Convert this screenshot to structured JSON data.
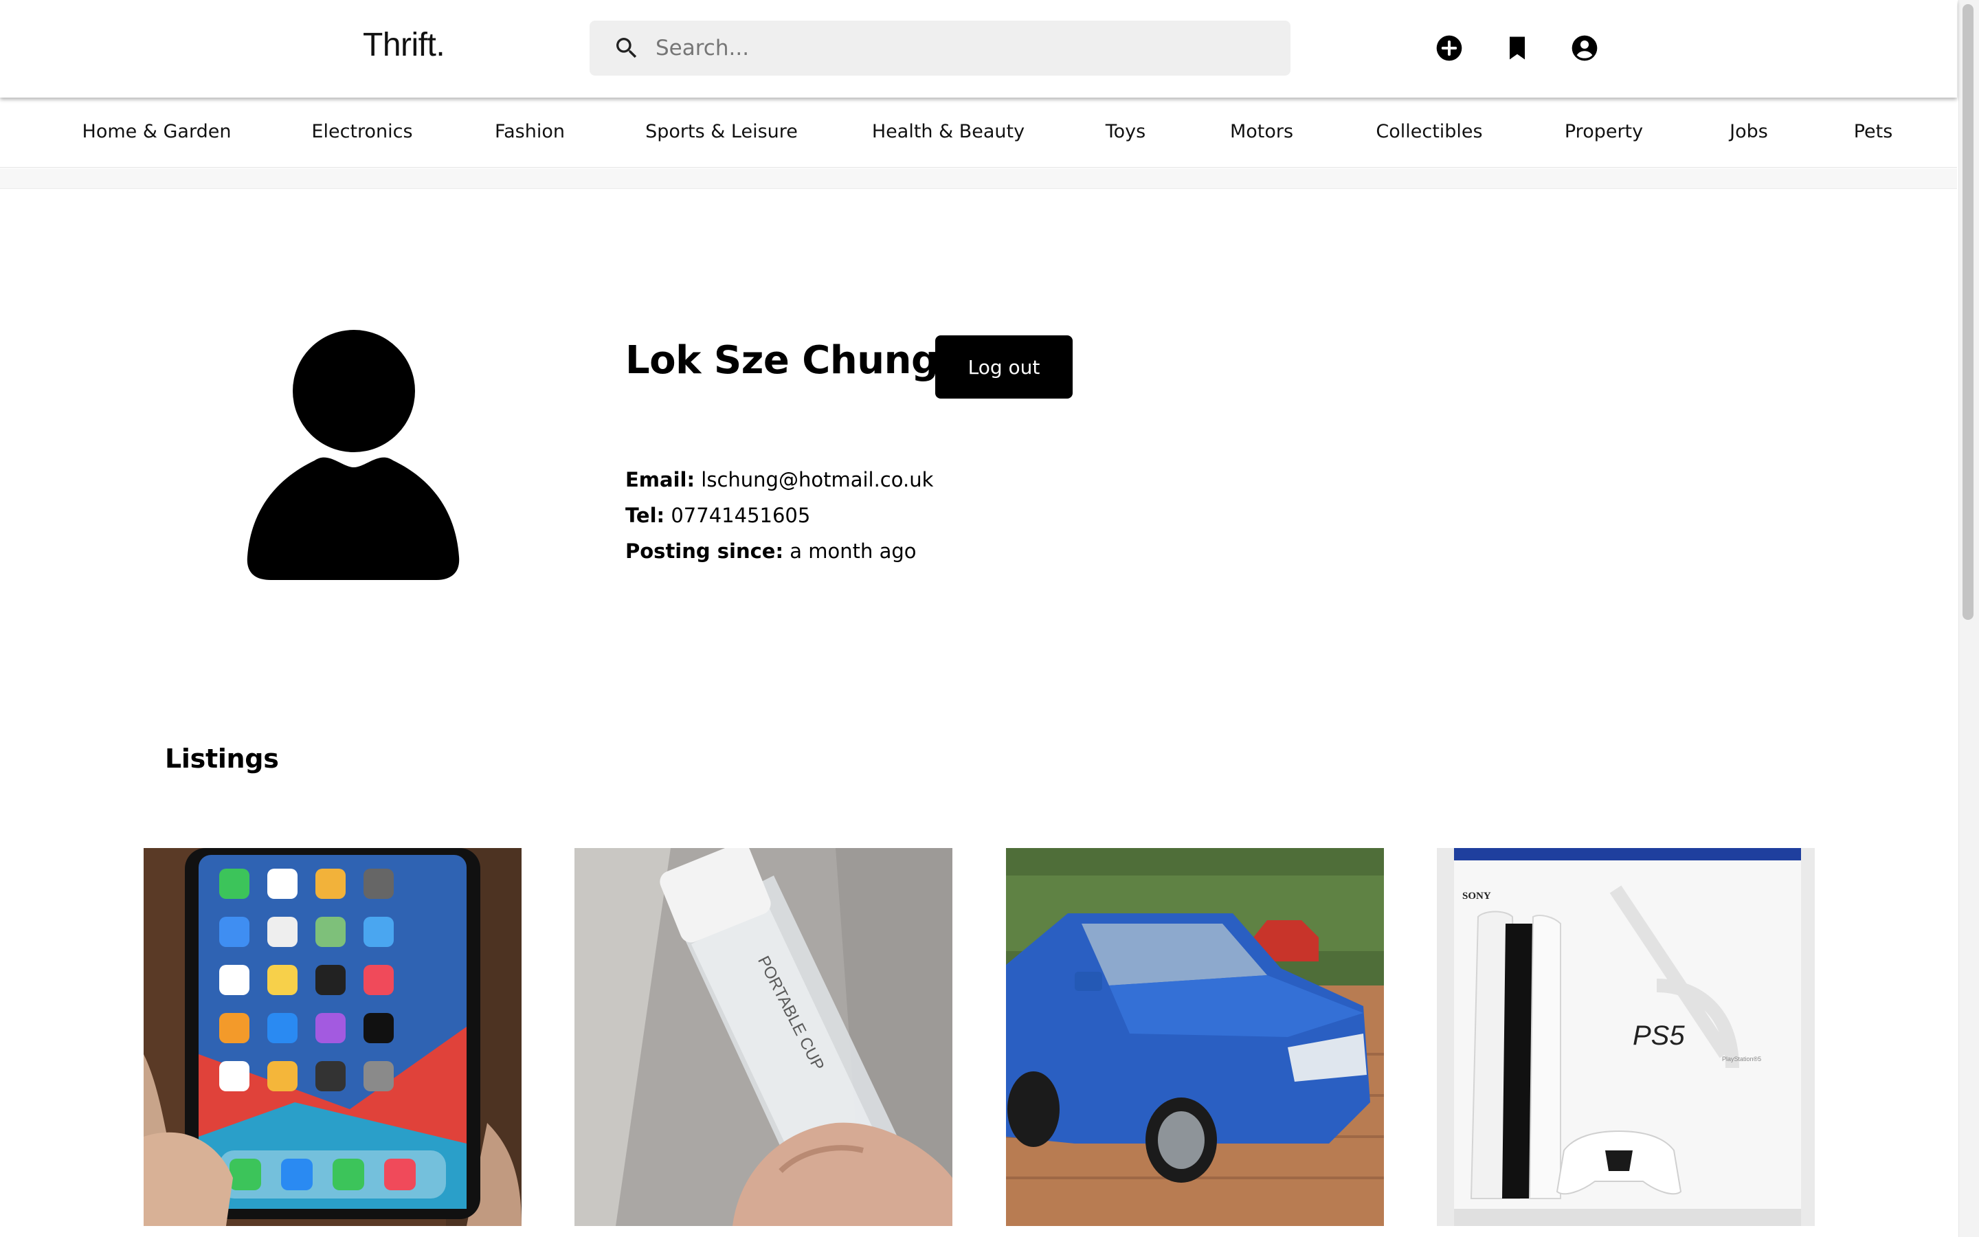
{
  "header": {
    "logo": "Thrift.",
    "search": {
      "placeholder": "Search..."
    },
    "icons": [
      "add-circle-icon",
      "bookmark-icon",
      "account-circle-icon"
    ]
  },
  "categories": [
    "Home & Garden",
    "Electronics",
    "Fashion",
    "Sports & Leisure",
    "Health & Beauty",
    "Toys",
    "Motors",
    "Collectibles",
    "Property",
    "Jobs",
    "Pets"
  ],
  "profile": {
    "name": "Lok Sze Chung",
    "logout_label": "Log out",
    "email_label": "Email:",
    "email": "lschung@hotmail.co.uk",
    "tel_label": "Tel:",
    "tel": "07741451605",
    "since_label": "Posting since:",
    "since": "a month ago"
  },
  "listings": {
    "title": "Listings",
    "items": [
      {
        "image": "iphone-photo"
      },
      {
        "image": "portable-cup-photo"
      },
      {
        "image": "blue-car-photo"
      },
      {
        "image": "ps5-box-photo"
      }
    ]
  },
  "photo_text": {
    "cup_brand": "PORTABLE CUP",
    "box_brand": "SONY",
    "box_product": "PS5",
    "box_sub": "PlayStation®5"
  },
  "colors": {
    "accent": "#000000",
    "search_bg": "#efefef",
    "background": "#ffffff"
  }
}
